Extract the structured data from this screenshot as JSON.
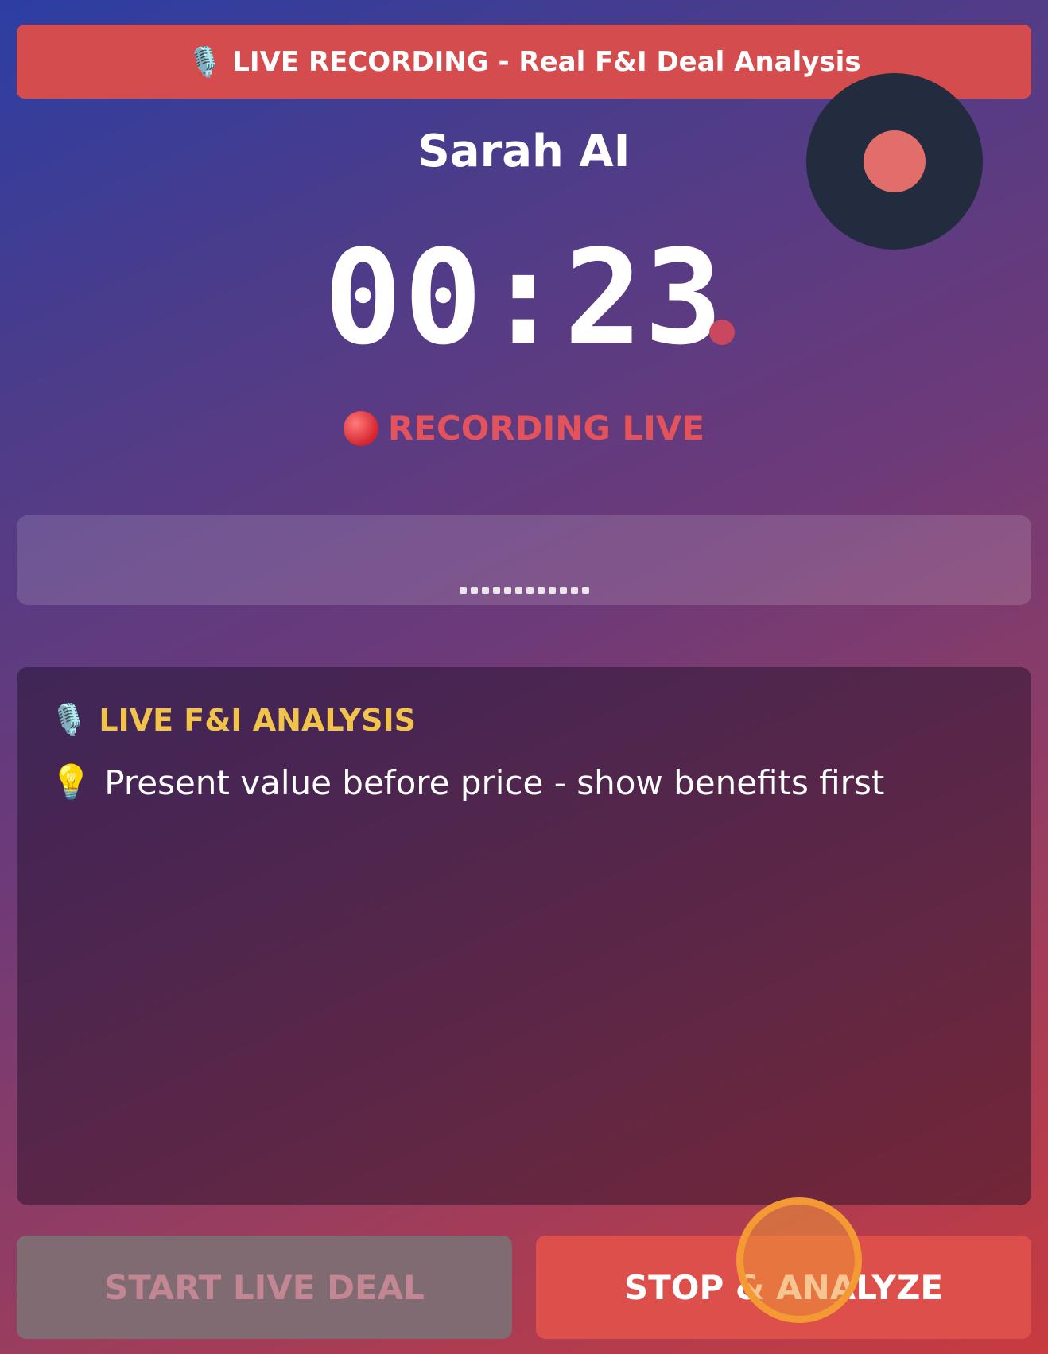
{
  "banner": {
    "icon": "microphone-icon",
    "text": "LIVE RECORDING - Real F&I Deal Analysis"
  },
  "app": {
    "title": "Sarah AI"
  },
  "timer": {
    "value": "00:23"
  },
  "status": {
    "icon": "red-dot-icon",
    "text": "RECORDING LIVE"
  },
  "analysis": {
    "icon": "microphone-icon",
    "heading": "LIVE F&I ANALYSIS",
    "tips": [
      {
        "icon": "lightbulb-icon",
        "text": "Present value before price - show benefits first"
      }
    ]
  },
  "buttons": {
    "start_label": "START LIVE DEAL",
    "stop_label": "STOP & ANALYZE"
  },
  "colors": {
    "banner": "#d44c4d",
    "status_text": "#e4535b",
    "analysis_heading": "#f2c34b",
    "stop_button": "#dc4f4a",
    "start_button_disabled": "#7f6b71",
    "record_orb": "#232b3e",
    "record_dot": "#e16e6a"
  }
}
